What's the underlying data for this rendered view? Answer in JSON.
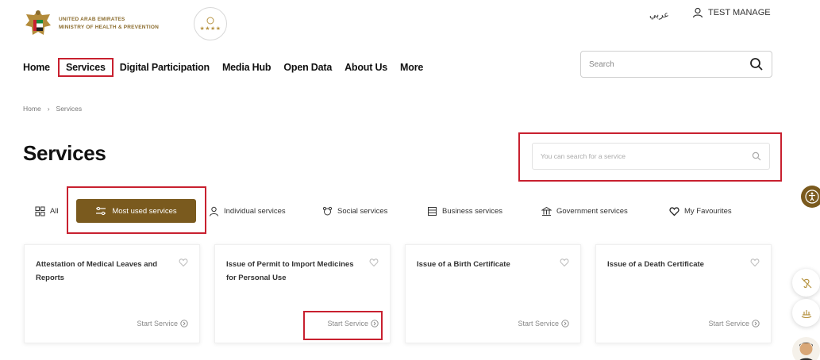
{
  "header": {
    "logo_line1": "UNITED ARAB EMIRATES",
    "logo_line2": "MINISTRY OF HEALTH & PREVENTION",
    "stars": "★★★★",
    "language": "عربي",
    "user": "TEST MANAGE"
  },
  "nav": {
    "items": [
      "Home",
      "Services",
      "Digital Participation",
      "Media Hub",
      "Open Data",
      "About Us",
      "More"
    ],
    "search_placeholder": "Search"
  },
  "breadcrumb": [
    "Home",
    "›",
    "Services"
  ],
  "page": {
    "title": "Services",
    "service_search_placeholder": "You can search for a service"
  },
  "tabs": {
    "all": "All",
    "most_used": "Most used services",
    "individual": "Individual services",
    "social": "Social services",
    "business": "Business services",
    "government": "Government services",
    "favourites": "My Favourites"
  },
  "cards": [
    {
      "title": "Attestation of Medical Leaves and Reports",
      "action": "Start Service"
    },
    {
      "title": "Issue of Permit to Import Medicines for Personal Use",
      "action": "Start Service"
    },
    {
      "title": "Issue of a Birth Certificate",
      "action": "Start Service"
    },
    {
      "title": "Issue of a Death Certificate",
      "action": "Start Service"
    }
  ],
  "colors": {
    "accent": "#7a5a1e",
    "highlight": "#c8202f"
  }
}
